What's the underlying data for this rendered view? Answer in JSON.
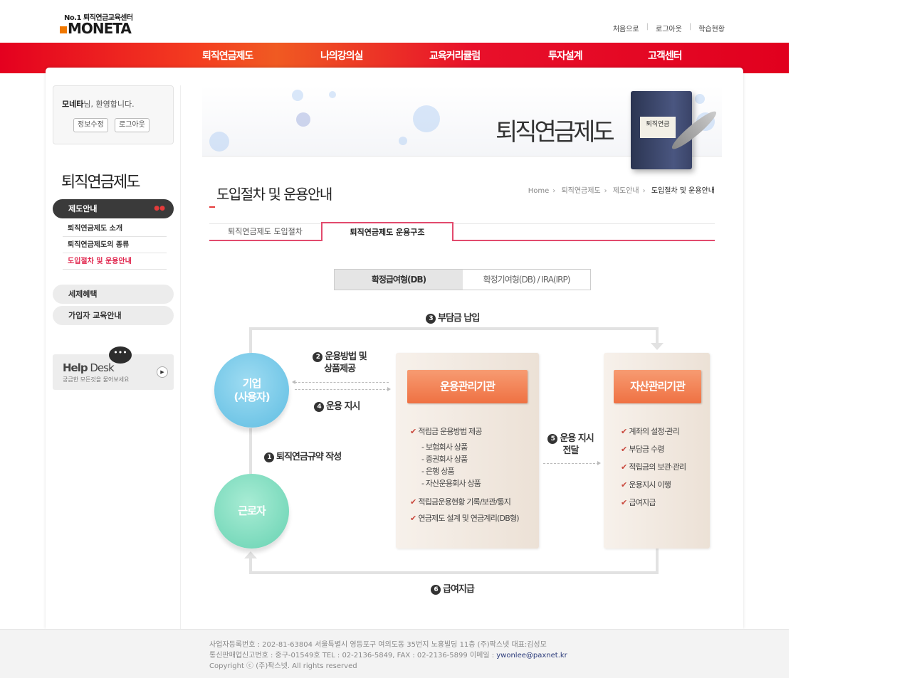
{
  "header": {
    "logo_sub": "No.1 퇴직연금교육센터",
    "logo_main": "MONETA",
    "top_links": [
      "처음으로",
      "로그아웃",
      "학습현황"
    ]
  },
  "gnb": [
    "퇴직연금제도",
    "나의강의실",
    "교육커리큘럼",
    "투자설계",
    "고객센터"
  ],
  "welcome": {
    "name": "모네타",
    "suffix": "님, 환영합니다.",
    "edit_btn": "정보수정",
    "logout_btn": "로그아웃"
  },
  "sidebar": {
    "title": "퇴직연금제도",
    "active": "제도안내",
    "sub_items": [
      "퇴직연금제도 소개",
      "퇴직연금제도의 종류",
      "도입절차 및 운용안내"
    ],
    "menu": [
      "세제혜택",
      "가입자 교육안내"
    ],
    "helpdesk_title_bold": "Help",
    "helpdesk_title": " Desk",
    "helpdesk_sub": "궁금한 모든것을 물어보세요"
  },
  "banner": {
    "title": "퇴직연금제도",
    "book_label": "퇴직연금"
  },
  "page": {
    "title": "도입절차 및 운용안내",
    "breadcrumb": [
      "Home",
      "퇴직연금제도",
      "제도안내",
      "도입절차 및 운용안내"
    ],
    "tabs": [
      "퇴직연금제도 도입절차",
      "퇴직연금제도 운용구조"
    ],
    "toggle": [
      "확정급여형(DB)",
      "확정기여형(DB) / IRA(IRP)"
    ]
  },
  "diagram": {
    "step3": "부담금 납입",
    "step2_line1": "운용방법 및",
    "step2_line2": "상품제공",
    "step4": "운용 지시",
    "step1": "퇴직연금규약 작성",
    "step5_line1": "운용 지시",
    "step5_line2": "전달",
    "step6": "급여지급",
    "circle1_line1": "기업",
    "circle1_line2": "(사용자)",
    "circle2": "근로자",
    "box1_title": "운용관리기관",
    "box1_items": [
      "적립금 운용방법 제공",
      "- 보험회사 상품",
      "- 증권회사 상품",
      "- 은행 상품",
      "- 자산운용회사 상품",
      "적립금운용현황 기록/보관/통지",
      "연금제도 설계 및 연금계리(DB형)"
    ],
    "box2_title": "자산관리기관",
    "box2_items": [
      "계좌의 설정·관리",
      "부담금 수령",
      "적립금의 보관·관리",
      "운용지시 이행",
      "급여지급"
    ]
  },
  "footer": {
    "line1": "사업자등록번호 : 202-81-63804 서울특별시 영등포구 여의도동 35번지 노홍빌딩 11층 (주)팍스넷 대표:김성모",
    "line2": "통신판매업신고번호 : 중구-01549호 TEL : 02-2136-5849, FAX : 02-2136-5899 이메일 : ",
    "email": "ywonlee@paxnet.kr",
    "line3": "Copyright ⓒ (주)팍스넷. All rights reserved"
  }
}
